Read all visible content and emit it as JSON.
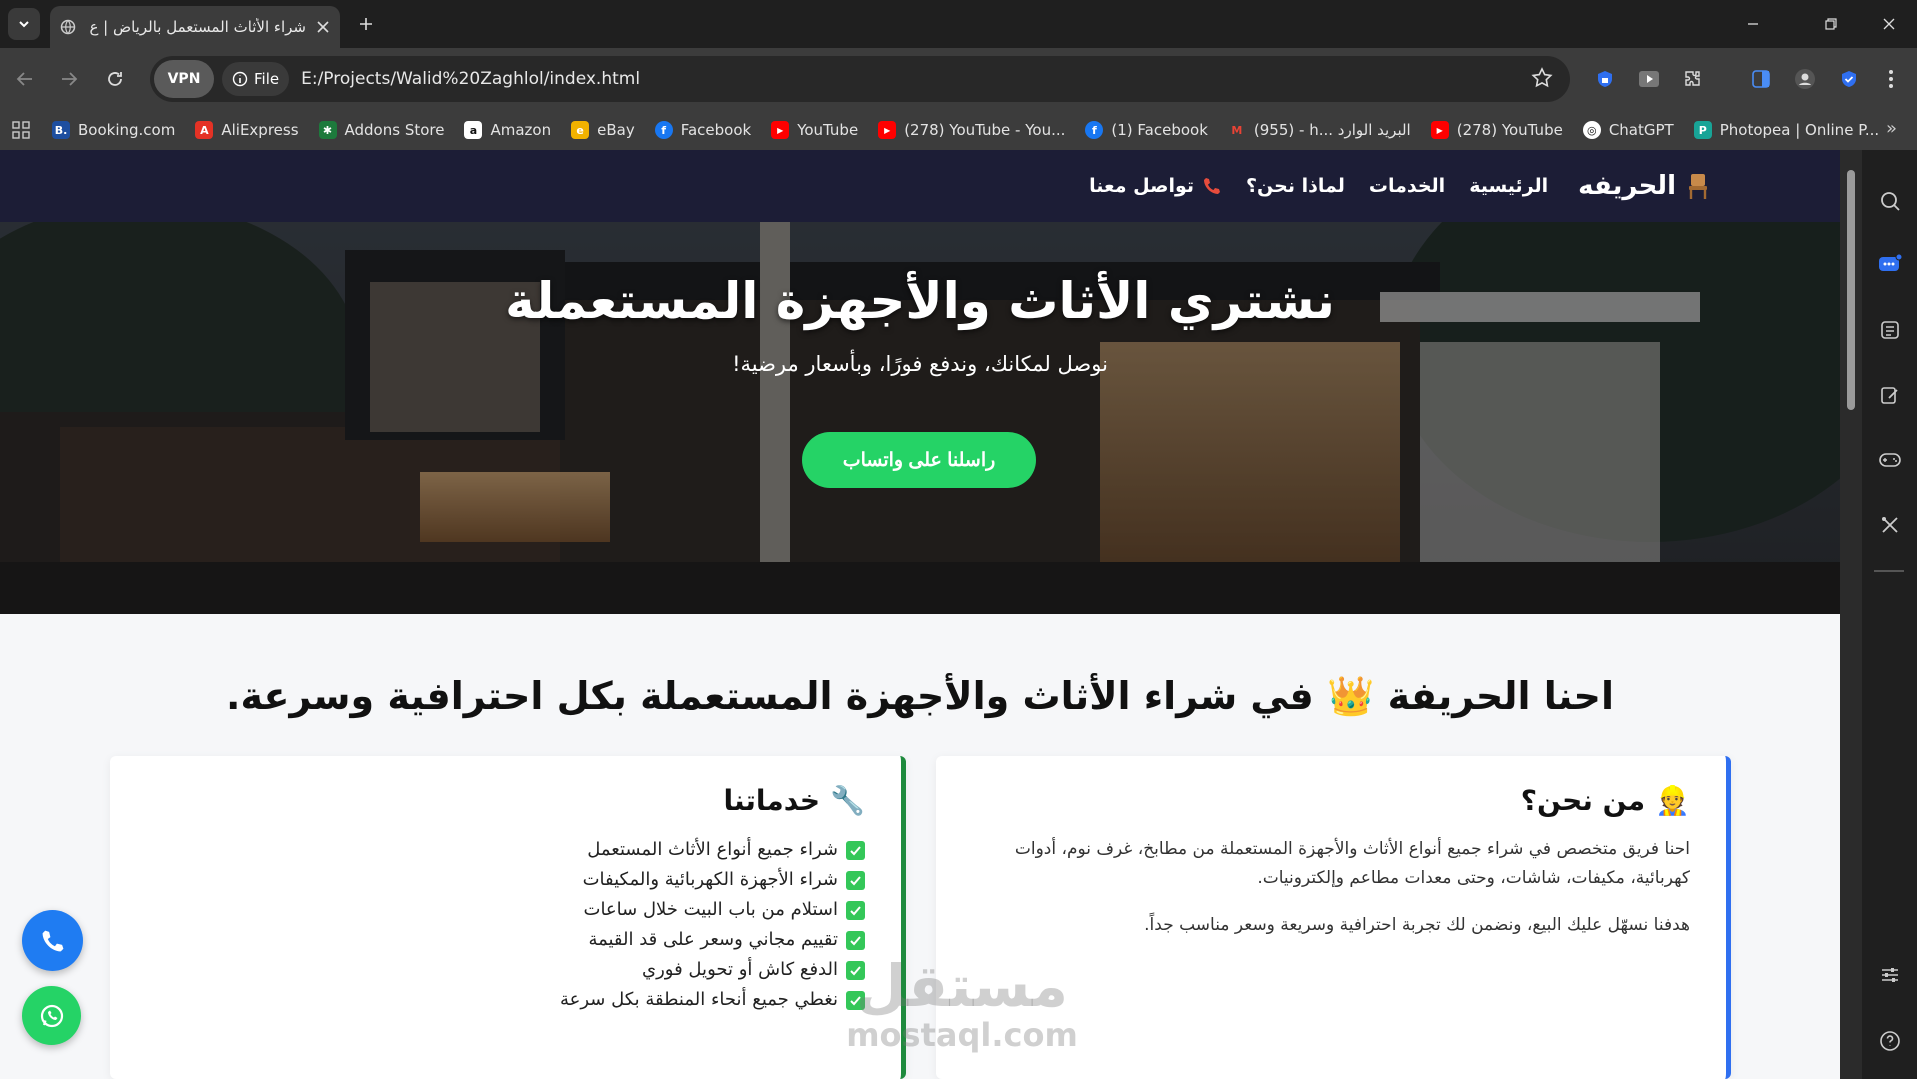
{
  "browser": {
    "tab_title": "شراء الأثاث المستعمل بالرياض | ع",
    "vpn_label": "VPN",
    "file_label": "File",
    "url": "E:/Projects/Walid%20Zaghlol/index.html",
    "bookmarks": [
      {
        "label": "Booking.com",
        "color": "#1e4fa0",
        "glyph": "B."
      },
      {
        "label": "AliExpress",
        "color": "#e43225",
        "glyph": "A"
      },
      {
        "label": "Addons Store",
        "color": "#1d7a3c",
        "glyph": "✱"
      },
      {
        "label": "Amazon",
        "color": "#ffffff",
        "glyph": "a"
      },
      {
        "label": "eBay",
        "color": "#f2b200",
        "glyph": "e"
      },
      {
        "label": "Facebook",
        "color": "#1877f2",
        "glyph": "f"
      },
      {
        "label": "YouTube",
        "color": "#ff0000",
        "glyph": "▶"
      },
      {
        "label": "(278) YouTube - You...",
        "color": "#ff0000",
        "glyph": "▶"
      },
      {
        "label": "(1) Facebook",
        "color": "#1877f2",
        "glyph": "f"
      },
      {
        "label": "(955) - h... البريد الوارد",
        "color": "#ea4335",
        "glyph": "M"
      },
      {
        "label": "(278) YouTube",
        "color": "#ff0000",
        "glyph": "▶"
      },
      {
        "label": "ChatGPT",
        "color": "#ffffff",
        "glyph": "◎"
      },
      {
        "label": "Photopea | Online P...",
        "color": "#18a497",
        "glyph": "P"
      }
    ]
  },
  "site": {
    "brand": "الحريفه",
    "nav": {
      "home": "الرئيسية",
      "services": "الخدمات",
      "why": "لماذا نحن؟",
      "contact": "تواصل معنا"
    },
    "hero": {
      "title": "نشتري الأثاث والأجهزة المستعملة",
      "subtitle": "نوصل لمكانك، وندفع فورًا، وبأسعار مرضية!",
      "cta": "راسلنا على واتساب"
    },
    "headline_before": "احنا الحريفة",
    "headline_after": "في شراء الأثاث والأجهزة المستعملة بكل احترافية وسرعة.",
    "who": {
      "title": "من نحن؟",
      "p1": "احنا فريق متخصص في شراء جميع أنواع الأثاث والأجهزة المستعملة من مطابخ، غرف نوم، أدوات كهربائية، مكيفات، شاشات، وحتى معدات مطاعم وإلكترونيات.",
      "p2": "هدفنا نسهّل عليك البيع، ونضمن لك تجربة احترافية وسريعة وسعر مناسب جداً."
    },
    "services": {
      "title": "خدماتنا",
      "items": [
        "شراء جميع أنواع الأثاث المستعمل",
        "شراء الأجهزة الكهربائية والمكيفات",
        "استلام من باب البيت خلال ساعات",
        "تقييم مجاني وسعر على قد القيمة",
        "الدفع كاش أو تحويل فوري",
        "نغطي جميع أنحاء المنطقة بكل سرعة"
      ]
    },
    "watermark_ar": "مستقل",
    "watermark_en": "mostaql.com"
  },
  "colors": {
    "nav_bg": "#1c1d36",
    "whatsapp_green": "#25d366",
    "call_blue": "#1f7cf2",
    "who_border": "#2f6ff0",
    "services_border": "#1e8a3d"
  }
}
